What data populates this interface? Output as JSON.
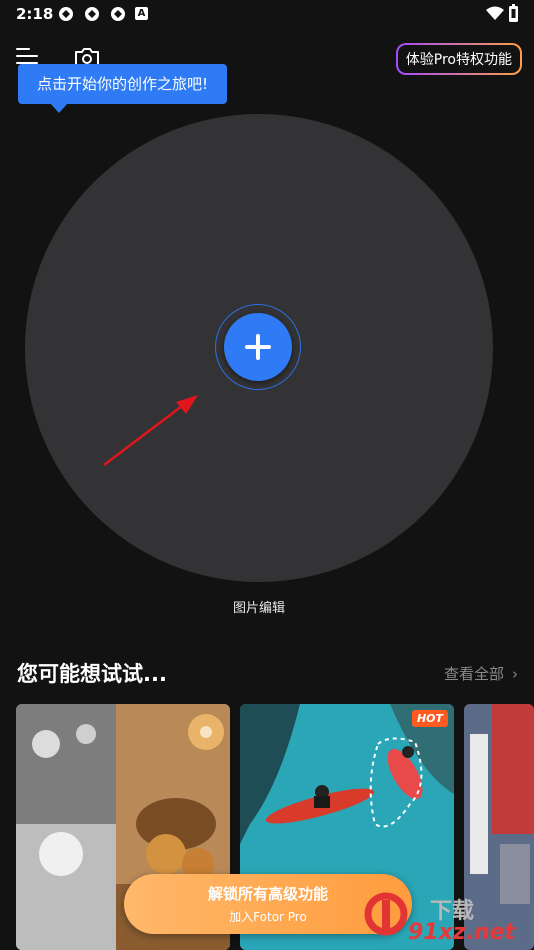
{
  "status_bar": {
    "time": "2:18",
    "notif_letter": "A"
  },
  "toolbar": {
    "pro_label": "体验Pro特权功能"
  },
  "tooltip": {
    "text": "点击开始你的创作之旅吧!"
  },
  "canvas": {
    "edit_label": "图片编辑"
  },
  "section": {
    "title": "您可能想试试...",
    "view_all": "查看全部",
    "view_all_chevron": "›"
  },
  "cards": [
    {
      "id": "food"
    },
    {
      "id": "kayak",
      "badge": "HOT"
    },
    {
      "id": "city"
    }
  ],
  "unlock": {
    "title": "解锁所有高级功能",
    "subtitle": "加入Fotor Pro"
  },
  "watermark": {
    "brand": "91xz.net",
    "top_text": "下载"
  },
  "colors": {
    "accent": "#2f7bf5",
    "background": "#121212",
    "circle": "#333335",
    "hot": "#ff5a1f",
    "unlock": "#ffa84f"
  }
}
